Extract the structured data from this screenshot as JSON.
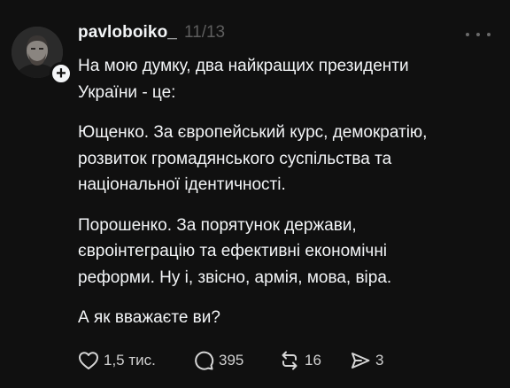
{
  "post": {
    "username": "pavloboiko_",
    "thread_counter": "11/13",
    "paragraphs": [
      "На мою думку, два найкращих президенти\nУкраїни - це:",
      "Ющенко. За європейський курс, демократію,\nрозвиток громадянського суспільства та\nнаціональної ідентичності.",
      "Порошенко. За порятунок держави,\nєвроінтеграцію та ефективні економічні\nреформи. Ну і, звісно, армія, мова, віра.",
      "А як вважаєте ви?"
    ],
    "actions": {
      "likes": "1,5 тис.",
      "replies": "395",
      "reposts": "16",
      "shares": "3"
    }
  },
  "icons": [
    "plus-icon",
    "more-icon",
    "heart-icon",
    "comment-icon",
    "repost-icon",
    "share-icon"
  ],
  "colors": {
    "background": "#101010",
    "text": "#f3f5f7",
    "secondary": "#5e5e5e"
  }
}
